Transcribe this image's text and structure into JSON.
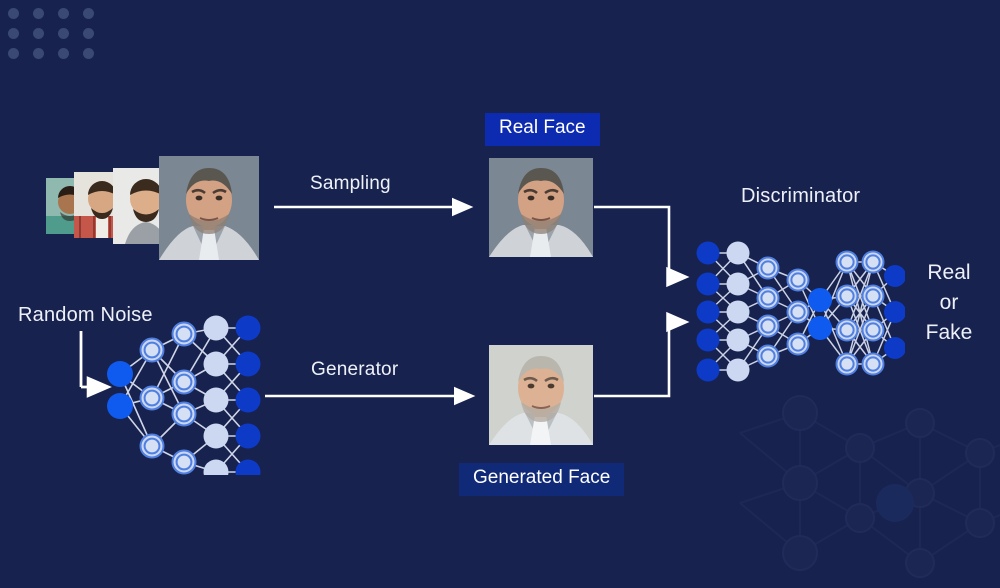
{
  "diagram": {
    "title": "GAN (Generative Adversarial Network) architecture",
    "background_color": "#17224f",
    "accent_color": "#0d2bb0",
    "node_blue": "#0f5bf0",
    "node_dark_blue": "#0d3bc8",
    "node_light": "#ccd7f2"
  },
  "labels": {
    "sampling": "Sampling",
    "generator": "Generator",
    "discriminator": "Discriminator",
    "random_noise": "Random Noise",
    "real_face": "Real Face",
    "generated_face": "Generated Face"
  },
  "verdict": {
    "line1": "Real",
    "line2": "or",
    "line3": "Fake"
  },
  "photos": {
    "dataset_stack": [
      {
        "name": "dataset-face-1",
        "alt": "man in teal shirt smiling",
        "bg": "#8fb9ae",
        "skin": "#a9754e",
        "hair": "#2a1d16",
        "shirt": "#4f9c8c"
      },
      {
        "name": "dataset-face-2",
        "alt": "bearded man in plaid shirt",
        "bg": "#e6e2dc",
        "skin": "#d6a782",
        "hair": "#3a2a1d",
        "shirt": "#c4564a"
      },
      {
        "name": "dataset-face-3",
        "alt": "man in grey sweater",
        "bg": "#e9e9e7",
        "skin": "#dcae89",
        "hair": "#3b2b1e",
        "shirt": "#9aa0a6"
      },
      {
        "name": "dataset-face-4",
        "alt": "man in suit with serious expression",
        "bg": "#6f7c86",
        "skin": "#d3a184",
        "hair": "#5a5750",
        "shirt": "#cfd3d8"
      }
    ],
    "real_face": {
      "name": "real-face-photo",
      "alt": "real face of man in suit",
      "bg": "#6f7c86",
      "skin": "#d3a184",
      "hair": "#5a5750",
      "shirt": "#cfd3d8"
    },
    "generated_face": {
      "name": "generated-face-photo",
      "alt": "generated face of man with grey hair",
      "bg": "#cfd2cd",
      "skin": "#ddb294",
      "hair": "#b9b6ae",
      "shirt": "#dfe2e4"
    }
  },
  "networks": {
    "generator": {
      "name": "generator-network",
      "direction": "expanding",
      "layers": [
        {
          "count": 2,
          "style": "solid-bright"
        },
        {
          "count": 3,
          "style": "ring"
        },
        {
          "count": 4,
          "style": "ring"
        },
        {
          "count": 5,
          "style": "solid-light"
        },
        {
          "count": 5,
          "style": "solid-dark"
        }
      ]
    },
    "discriminator": {
      "name": "discriminator-network",
      "direction": "tapering-then-expanding",
      "layers": [
        {
          "count": 5,
          "style": "solid-dark"
        },
        {
          "count": 5,
          "style": "solid-light"
        },
        {
          "count": 4,
          "style": "ring"
        },
        {
          "count": 3,
          "style": "ring"
        },
        {
          "count": 2,
          "style": "solid-bright"
        },
        {
          "count": 4,
          "style": "ring"
        },
        {
          "count": 4,
          "style": "ring"
        },
        {
          "count": 3,
          "style": "solid-dark"
        }
      ]
    }
  },
  "flow": {
    "edges": [
      {
        "name": "sampling-arrow",
        "from": "dataset-stack",
        "to": "real-face-photo",
        "label": "Sampling"
      },
      {
        "name": "generator-arrow",
        "from": "generator-network",
        "to": "generated-face-photo",
        "label": "Generator"
      },
      {
        "name": "noise-arrow",
        "from": "random-noise-label",
        "to": "generator-network",
        "label": ""
      },
      {
        "name": "real-to-discriminator-arrow",
        "from": "real-face-photo",
        "to": "discriminator-network",
        "label": ""
      },
      {
        "name": "generated-to-discriminator-arrow",
        "from": "generated-face-photo",
        "to": "discriminator-network",
        "label": ""
      }
    ]
  }
}
